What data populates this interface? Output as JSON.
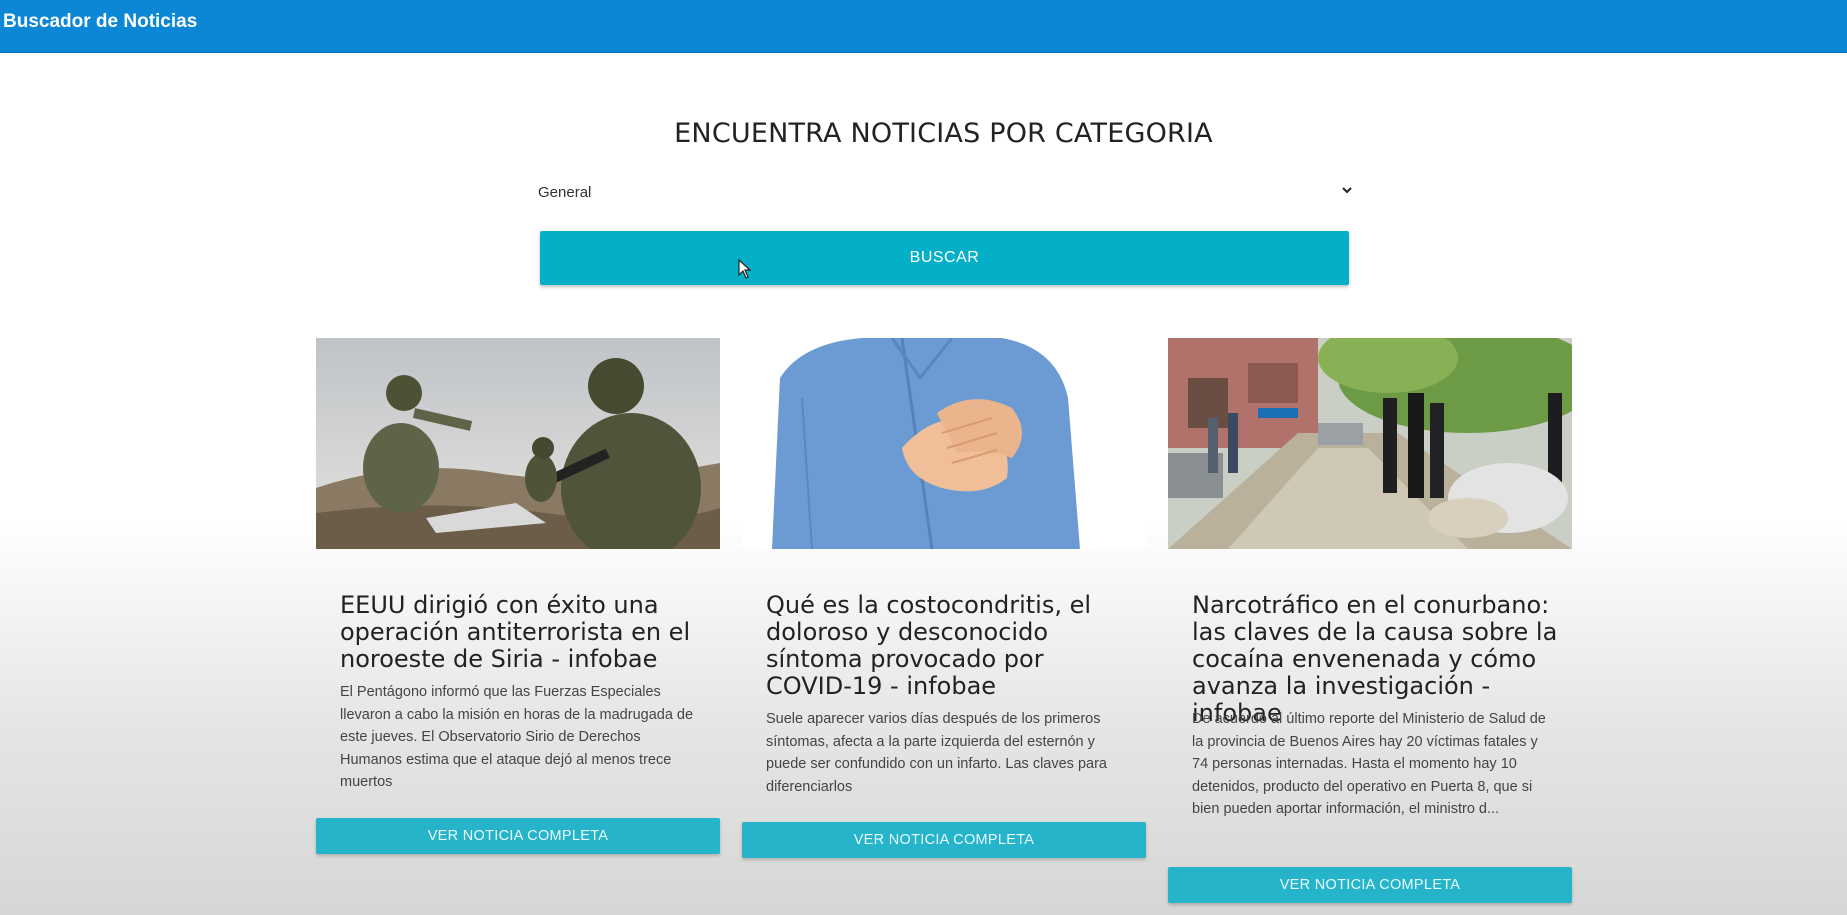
{
  "header": {
    "brand": "Buscador de Noticias",
    "color": "#0b87d6"
  },
  "search": {
    "heading": "ENCUENTRA NOTICIAS POR CATEGORIA",
    "category_selected": "General",
    "button_label": "BUSCAR",
    "button_color": "#04b0c8"
  },
  "news": [
    {
      "title": "EEUU dirigió con éxito una operación antiterrorista en el noroeste de Siria - infobae",
      "description": "El Pentágono informó que las Fuerzas Especiales llevaron a cabo la misión en horas de la madrugada de este jueves. El Observatorio Sirio de Derechos Humanos estima que el ataque dejó al menos trece muertos",
      "button_label": "VER NOTICIA COMPLETA"
    },
    {
      "title": "Qué es la costocondritis, el doloroso y desconocido síntoma provocado por COVID-19 - infobae",
      "description": "Suele aparecer varios días después de los primeros síntomas, afecta a la parte izquierda del esternón y puede ser confundido con un infarto. Las claves para diferenciarlos",
      "button_label": "VER NOTICIA COMPLETA"
    },
    {
      "title": "Narcotráfico en el conurbano: las claves de la causa sobre la cocaína envenenada y cómo avanza la investigación - infobae",
      "description": "De acuerdo al último reporte del Ministerio de Salud de la provincia de Buenos Aires hay 20 víctimas fatales y 74 personas internadas. Hasta el momento hay 10 detenidos, producto del operativo en Puerta 8, que si bien pueden aportar información, el ministro d...",
      "button_label": "VER NOTICIA COMPLETA"
    }
  ]
}
